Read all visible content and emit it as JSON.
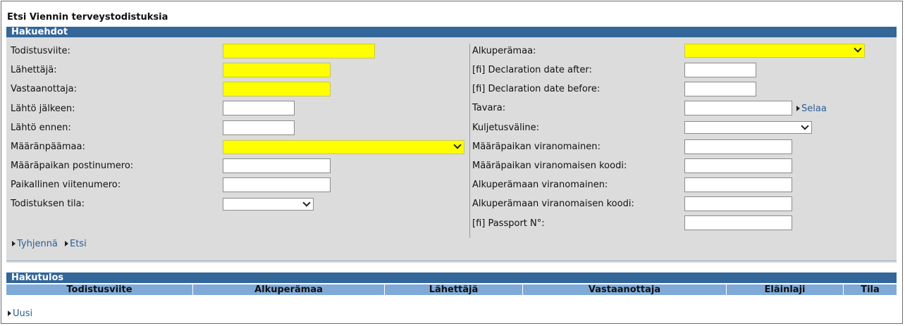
{
  "page": {
    "title": "Etsi Viennin terveystodistuksia"
  },
  "criteria": {
    "header": "Hakuehdot",
    "left_fields": [
      {
        "label": "Todistusviite:",
        "value": ""
      },
      {
        "label": "Lähettäjä:",
        "value": ""
      },
      {
        "label": "Vastaanottaja:",
        "value": ""
      },
      {
        "label": "Lähtö jälkeen:",
        "value": ""
      },
      {
        "label": "Lähtö ennen:",
        "value": ""
      },
      {
        "label": "Määränpäämaa:",
        "value": ""
      },
      {
        "label": "Määräpaikan postinumero:",
        "value": ""
      },
      {
        "label": "Paikallinen viitenumero:",
        "value": ""
      },
      {
        "label": "Todistuksen tila:",
        "value": ""
      }
    ],
    "right_fields": [
      {
        "label": "Alkuperämaa:",
        "value": ""
      },
      {
        "label": "[fi] Declaration date after:",
        "value": ""
      },
      {
        "label": "[fi] Declaration date before:",
        "value": ""
      },
      {
        "label": "Tavara:",
        "value": ""
      },
      {
        "label": "Kuljetusväline:",
        "value": ""
      },
      {
        "label": "Määräpaikan viranomainen:",
        "value": ""
      },
      {
        "label": "Määräpaikan viranomaisen koodi:",
        "value": ""
      },
      {
        "label": "Alkuperämaan viranomainen:",
        "value": ""
      },
      {
        "label": "Alkuperämaan viranomaisen koodi:",
        "value": ""
      },
      {
        "label": "[fi] Passport N°:",
        "value": ""
      }
    ],
    "browse_link": "Selaa",
    "clear_link": "Tyhjennä",
    "search_link": "Etsi",
    "highlight_color": "#ffff00"
  },
  "results": {
    "header": "Hakutulos",
    "columns": [
      "Todistusviite",
      "Alkuperämaa",
      "Lähettäjä",
      "Vastaanottaja",
      "Eläinlaji",
      "Tila"
    ],
    "rows": [],
    "new_link": "Uusi"
  },
  "colors": {
    "section_header": "#336699",
    "table_header": "#7faad8",
    "panel": "#dcdcdc",
    "link": "#2a5d95"
  }
}
